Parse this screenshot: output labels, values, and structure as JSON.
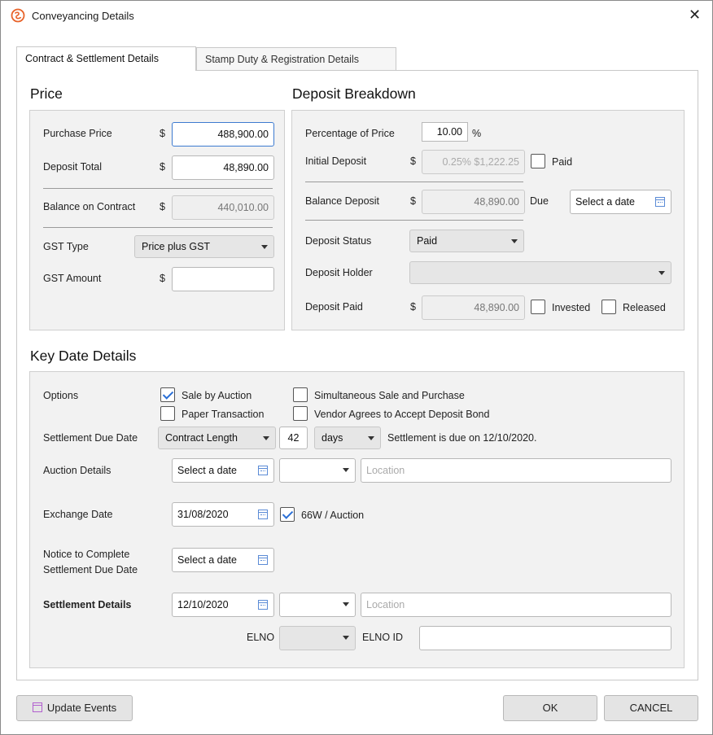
{
  "window": {
    "title": "Conveyancing Details"
  },
  "tabs": [
    "Contract & Settlement Details",
    "Stamp Duty & Registration Details"
  ],
  "price": {
    "title": "Price",
    "purchase_price_label": "Purchase Price",
    "purchase_price": "488,900.00",
    "deposit_total_label": "Deposit Total",
    "deposit_total": "48,890.00",
    "balance_label": "Balance on Contract",
    "balance": "440,010.00",
    "gst_type_label": "GST Type",
    "gst_type": "Price plus GST",
    "gst_amount_label": "GST Amount",
    "gst_amount": "",
    "currency": "$"
  },
  "deposit": {
    "title": "Deposit Breakdown",
    "percentage_label": "Percentage of Price",
    "percentage": "10.00",
    "percent_sign": "%",
    "initial_label": "Initial Deposit",
    "initial": "0.25% $1,222.25",
    "paid_label": "Paid",
    "balance_label": "Balance Deposit",
    "balance": "48,890.00",
    "due_label": "Due",
    "due_date": "Select a date",
    "status_label": "Deposit Status",
    "status": "Paid",
    "holder_label": "Deposit Holder",
    "holder": "",
    "paid_amount_label": "Deposit Paid",
    "paid_amount": "48,890.00",
    "invested_label": "Invested",
    "released_label": "Released"
  },
  "key_dates": {
    "title": "Key Date Details",
    "options_label": "Options",
    "opt_sale_by_auction": "Sale by Auction",
    "opt_simultaneous": "Simultaneous Sale and Purchase",
    "opt_paper": "Paper Transaction",
    "opt_vendor_bond": "Vendor Agrees to Accept Deposit Bond",
    "settlement_due_label": "Settlement Due Date",
    "contract_length": "Contract Length",
    "days_value": "42",
    "days_unit": "days",
    "settlement_note": "Settlement is due on 12/10/2020.",
    "auction_label": "Auction Details",
    "auction_date": "Select a date",
    "auction_location_placeholder": "Location",
    "exchange_label": "Exchange Date",
    "exchange_date": "31/08/2020",
    "exchange_66w": "66W / Auction",
    "notice_label_1": "Notice to Complete",
    "notice_label_2": "Settlement Due Date",
    "notice_date": "Select a date",
    "settlement_details_label": "Settlement Details",
    "settlement_date": "12/10/2020",
    "settlement_location_placeholder": "Location",
    "elno_label": "ELNO",
    "elno_id_label": "ELNO ID"
  },
  "footer": {
    "update_events": "Update Events",
    "ok": "OK",
    "cancel": "CANCEL"
  }
}
